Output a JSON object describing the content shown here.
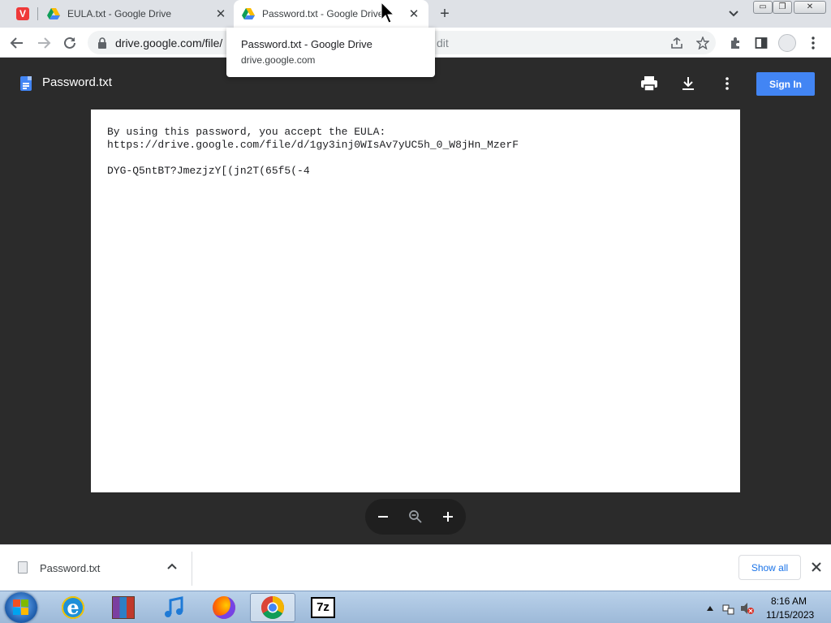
{
  "browser": {
    "tabs": [
      {
        "title": "",
        "icon": "vivaldi-icon"
      },
      {
        "title": "EULA.txt - Google Drive",
        "icon": "google-drive-icon"
      },
      {
        "title": "Password.txt - Google Drive",
        "icon": "google-drive-icon",
        "active": true
      }
    ],
    "window_controls": {
      "minimize": "▭",
      "restore": "❐",
      "close": "✕"
    },
    "address": {
      "url": "drive.google.com/file/",
      "url_tail": "dit"
    },
    "tooltip": {
      "title": "Password.txt - Google Drive",
      "host": "drive.google.com"
    }
  },
  "viewer": {
    "title": "Password.txt",
    "sign_in_label": "Sign In",
    "content_lines": [
      "By using this password, you accept the EULA:",
      "https://drive.google.com/file/d/1gy3inj0WIsAv7yUC5h_0_W8jHn_MzerF",
      "",
      "DYG-Q5ntBT?JmezjzY[(jn2T(65f5(-4"
    ]
  },
  "downloads": {
    "file_name": "Password.txt",
    "show_all_label": "Show all"
  },
  "taskbar": {
    "time": "8:16 AM",
    "date": "11/15/2023",
    "apps": [
      "internet-explorer-icon",
      "winrar-icon",
      "itunes-icon",
      "firefox-icon",
      "chrome-icon",
      "7zip-icon"
    ],
    "sevenzip_label": "7z"
  },
  "colors": {
    "accent": "#4285f4",
    "viewer_bg": "#2b2b2b",
    "link": "#1a73e8"
  }
}
